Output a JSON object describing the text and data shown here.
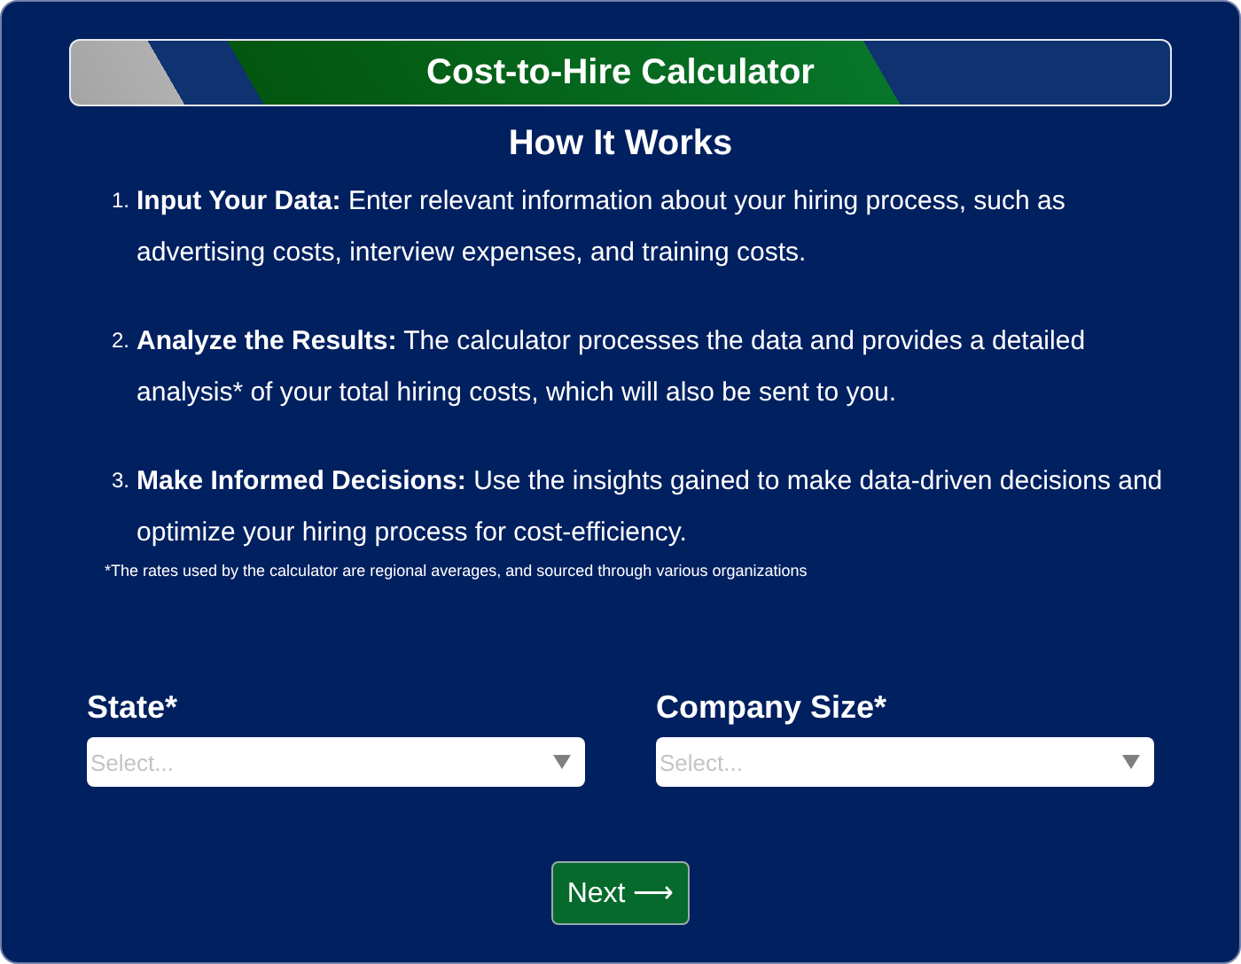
{
  "banner": {
    "title": "Cost-to-Hire Calculator"
  },
  "heading": "How It Works",
  "steps": [
    {
      "number": "1.",
      "text": "**Input Your Data:** Enter relevant information about your hiring process, such as advertising costs, interview expenses, and training costs."
    },
    {
      "number": "2.",
      "text": "**Analyze the Results:** The calculator processes the data and provides a detailed analysis* of your total hiring costs, which will also be sent to you."
    },
    {
      "number": "3.",
      "text": "**Make Informed Decisions:** Use the insights gained to make data-driven decisions and optimize your hiring process for cost-efficiency."
    }
  ],
  "footnote": "*The rates used by the calculator are regional averages, and sourced through various organizations",
  "fields": [
    {
      "label": "State*",
      "placeholder": "Select..."
    },
    {
      "label": "Company Size*",
      "placeholder": "Select..."
    }
  ],
  "next_button": "Next ⟶"
}
